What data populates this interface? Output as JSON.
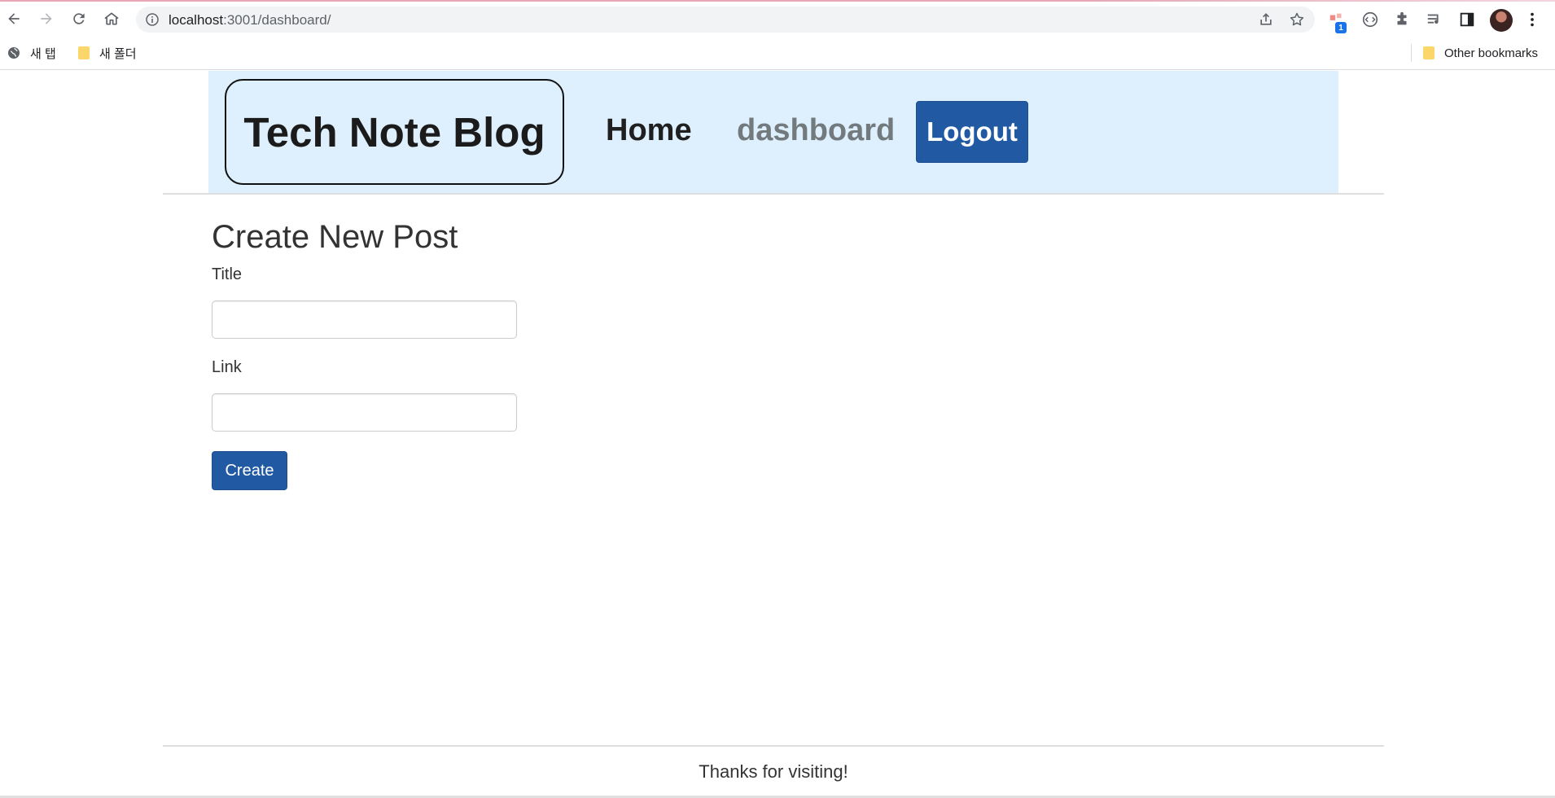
{
  "browser": {
    "url_host": "localhost",
    "url_rest": ":3001/dashboard/",
    "extension_badge": "1",
    "bookmarks": [
      {
        "label": "새 탭",
        "icon": "globe-icon"
      },
      {
        "label": "새 폴더",
        "icon": "folder-icon"
      }
    ],
    "other_bookmarks": "Other bookmarks"
  },
  "header": {
    "brand": "Tech Note Blog",
    "nav_home": "Home",
    "nav_dashboard": "dashboard",
    "logout": "Logout",
    "background_color": "#def0fd",
    "button_color": "#215aa3"
  },
  "form": {
    "heading": "Create New Post",
    "title_label": "Title",
    "title_value": "",
    "link_label": "Link",
    "link_value": "",
    "submit": "Create"
  },
  "footer": {
    "text": "Thanks for visiting!"
  }
}
